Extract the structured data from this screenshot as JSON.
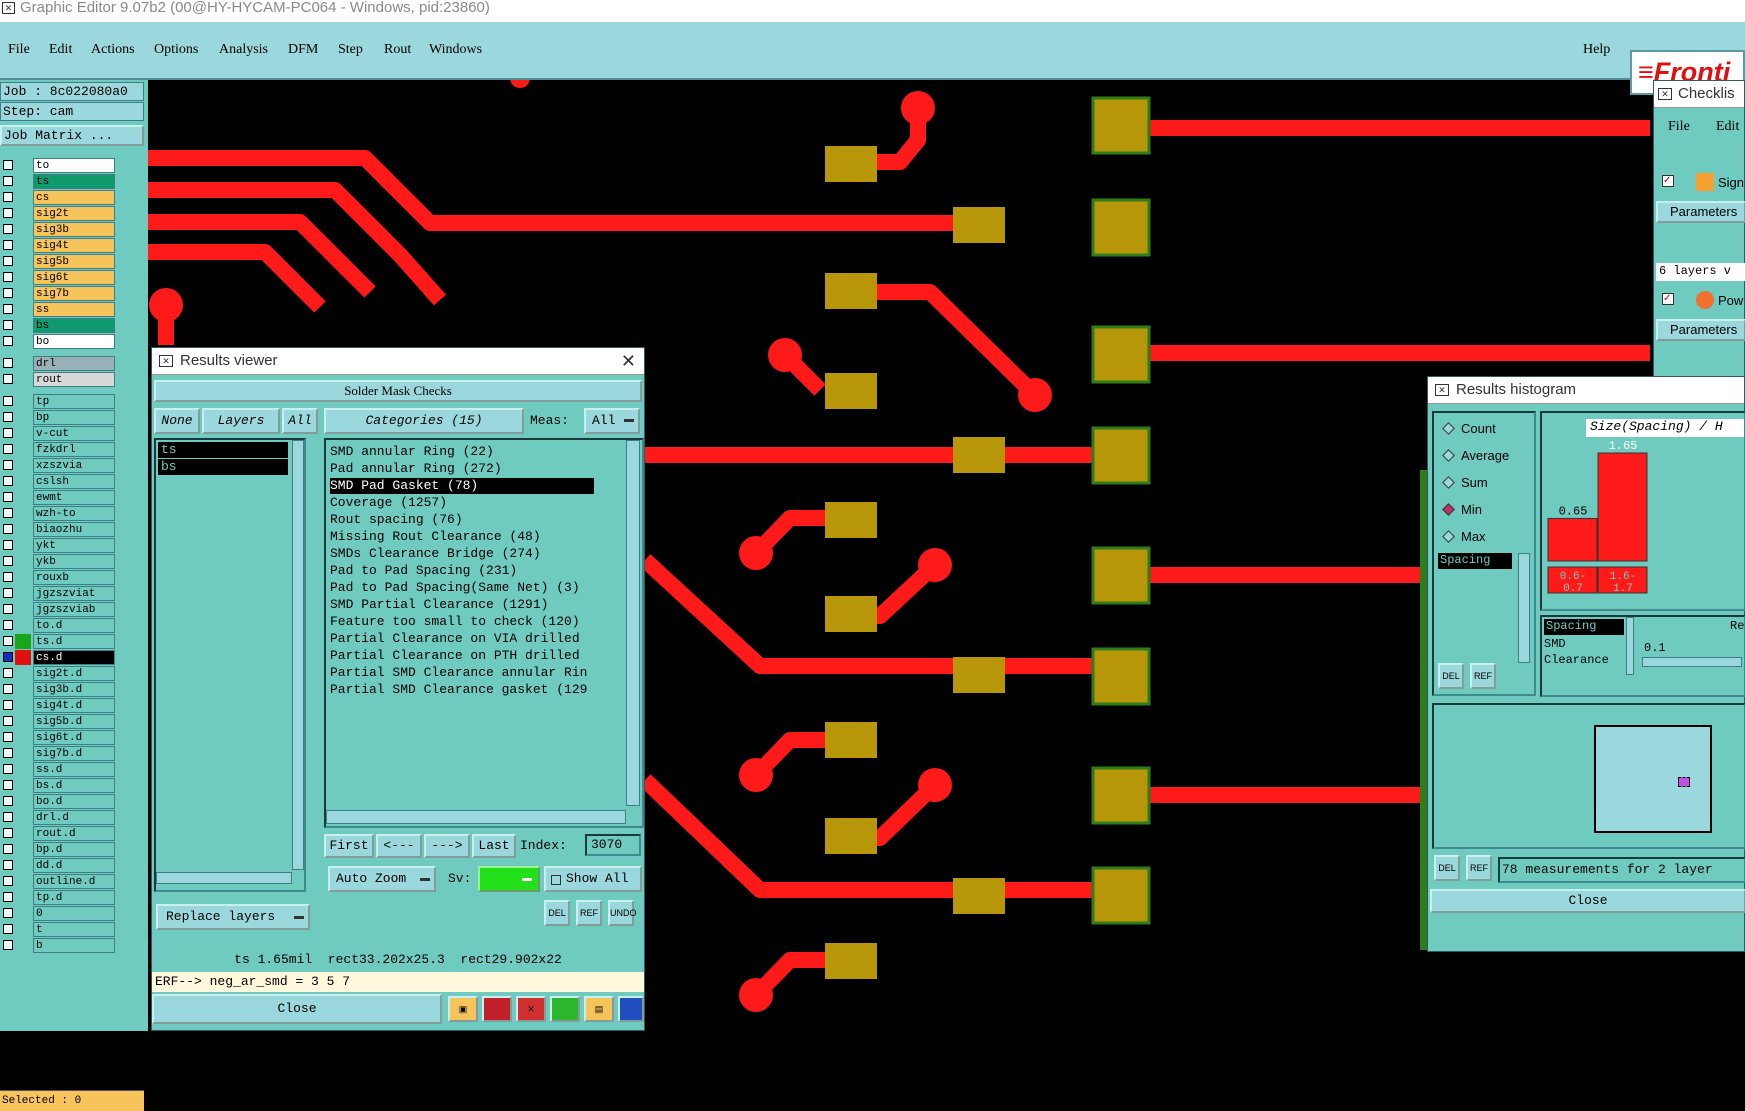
{
  "titlebar": {
    "title": "Graphic Editor 9.07b2 (00@HY-HYCAM-PC064 - Windows, pid:23860)"
  },
  "menu": {
    "items": [
      "File",
      "Edit",
      "Actions",
      "Options",
      "Analysis",
      "DFM",
      "Step",
      "Rout",
      "Windows"
    ],
    "help": "Help"
  },
  "logo": {
    "text": "≡Fronti"
  },
  "left": {
    "job": "Job : 8c022080a0",
    "step": "Step: cam",
    "job_matrix": "Job Matrix ...",
    "selected": "Selected : 0",
    "layers": [
      {
        "name": "to",
        "color": "#ffffff"
      },
      {
        "name": "ts",
        "color": "#0f9a6e"
      },
      {
        "name": "cs",
        "color": "#f6c45a"
      },
      {
        "name": "sig2t",
        "color": "#f6c45a"
      },
      {
        "name": "sig3b",
        "color": "#f6c45a"
      },
      {
        "name": "sig4t",
        "color": "#f6c45a"
      },
      {
        "name": "sig5b",
        "color": "#f6c45a"
      },
      {
        "name": "sig6t",
        "color": "#f6c45a"
      },
      {
        "name": "sig7b",
        "color": "#f6c45a"
      },
      {
        "name": "ss",
        "color": "#f6c45a"
      },
      {
        "name": "bs",
        "color": "#0f9a6e"
      },
      {
        "name": "bo",
        "color": "#ffffff"
      },
      {
        "name": "drl",
        "color": "#9ab0b8"
      },
      {
        "name": "rout",
        "color": "#d8d8d8"
      },
      {
        "name": "tp"
      },
      {
        "name": "bp"
      },
      {
        "name": "v-cut"
      },
      {
        "name": "fzkdrl"
      },
      {
        "name": "xzszvia"
      },
      {
        "name": "cslsh"
      },
      {
        "name": "ewmt"
      },
      {
        "name": "wzh-to"
      },
      {
        "name": "biaozhu"
      },
      {
        "name": "ykt"
      },
      {
        "name": "ykb"
      },
      {
        "name": "rouxb"
      },
      {
        "name": "jgzszviat"
      },
      {
        "name": "jgzszviab"
      },
      {
        "name": "to.d"
      },
      {
        "name": "ts.d",
        "swatch": "#1aa61a"
      },
      {
        "name": "cs.d",
        "swatch": "#e01010",
        "active": true
      },
      {
        "name": "sig2t.d"
      },
      {
        "name": "sig3b.d"
      },
      {
        "name": "sig4t.d"
      },
      {
        "name": "sig5b.d"
      },
      {
        "name": "sig6t.d"
      },
      {
        "name": "sig7b.d"
      },
      {
        "name": "ss.d"
      },
      {
        "name": "bs.d"
      },
      {
        "name": "bo.d"
      },
      {
        "name": "drl.d"
      },
      {
        "name": "rout.d"
      },
      {
        "name": "bp.d"
      },
      {
        "name": "dd.d"
      },
      {
        "name": "outline.d"
      },
      {
        "name": "tp.d"
      },
      {
        "name": "0"
      },
      {
        "name": "t"
      },
      {
        "name": "b"
      }
    ]
  },
  "results_viewer": {
    "title": "Results viewer",
    "header": "Solder Mask Checks",
    "none_btn": "None",
    "layers_btn": "Layers",
    "all_btn": "All",
    "categories_btn": "Categories (15)",
    "meas_label": "Meas:",
    "meas_value": "All",
    "layers": [
      "ts",
      "bs"
    ],
    "categories": [
      "SMD annular Ring (22)",
      "Pad annular Ring (272)",
      "SMD Pad Gasket (78)",
      "Coverage (1257)",
      "Rout spacing (76)",
      "Missing Rout Clearance (48)",
      "SMDs Clearance Bridge (274)",
      "Pad to Pad Spacing (231)",
      "Pad to Pad Spacing(Same Net) (3)",
      "SMD Partial Clearance (1291)",
      "Feature too small to check (120)",
      "Partial Clearance on VIA drilled",
      "Partial Clearance on PTH drilled",
      "Partial SMD Clearance annular Rin",
      "Partial SMD Clearance gasket (129"
    ],
    "selected_category_index": 2,
    "first": "First",
    "prev": "<---",
    "next": "--->",
    "last": "Last",
    "index_label": "Index:",
    "index_value": "3070",
    "auto_zoom": "Auto Zoom",
    "sv_label": "Sv:",
    "show_all": "Show All",
    "replace_layers": "Replace layers",
    "del": "DEL",
    "ref": "REF",
    "undo": "UNDO",
    "status": "ts 1.65mil  rect33.202x25.3  rect29.902x22",
    "erf": "ERF--> neg_ar_smd = 3 5 7",
    "close": "Close"
  },
  "checklist": {
    "title": "Checklis",
    "file": "File",
    "edit": "Edit",
    "item1": "Sign",
    "params1": "Parameters",
    "layers": "6 layers v",
    "item2": "Pow",
    "params2": "Parameters"
  },
  "histogram": {
    "title": "Results histogram",
    "options": [
      "Count",
      "Average",
      "Sum",
      "Min",
      "Max"
    ],
    "selected_option": "Min",
    "list": [
      "Spacing"
    ],
    "chart_title": "Size(Spacing) / H",
    "bars": [
      {
        "label": "0.6-0.7",
        "value": 0.65,
        "value_label": "0.65"
      },
      {
        "label": "1.6-1.7",
        "value": 1.65,
        "value_label": "1.65"
      }
    ],
    "cat_list": [
      "Spacing",
      "SMD",
      "Clearance"
    ],
    "re_label": "Re",
    "re_value": "0.1",
    "summary": "78 measurements for 2 layer",
    "close": "Close",
    "del": "DEL",
    "ref": "REF"
  },
  "colors": {
    "trace": "#ff1a1a",
    "pad": "#b8960a",
    "pad_border": "#2e7d1a",
    "panel": "#6fcbc0",
    "menu": "#9bd8dd"
  }
}
